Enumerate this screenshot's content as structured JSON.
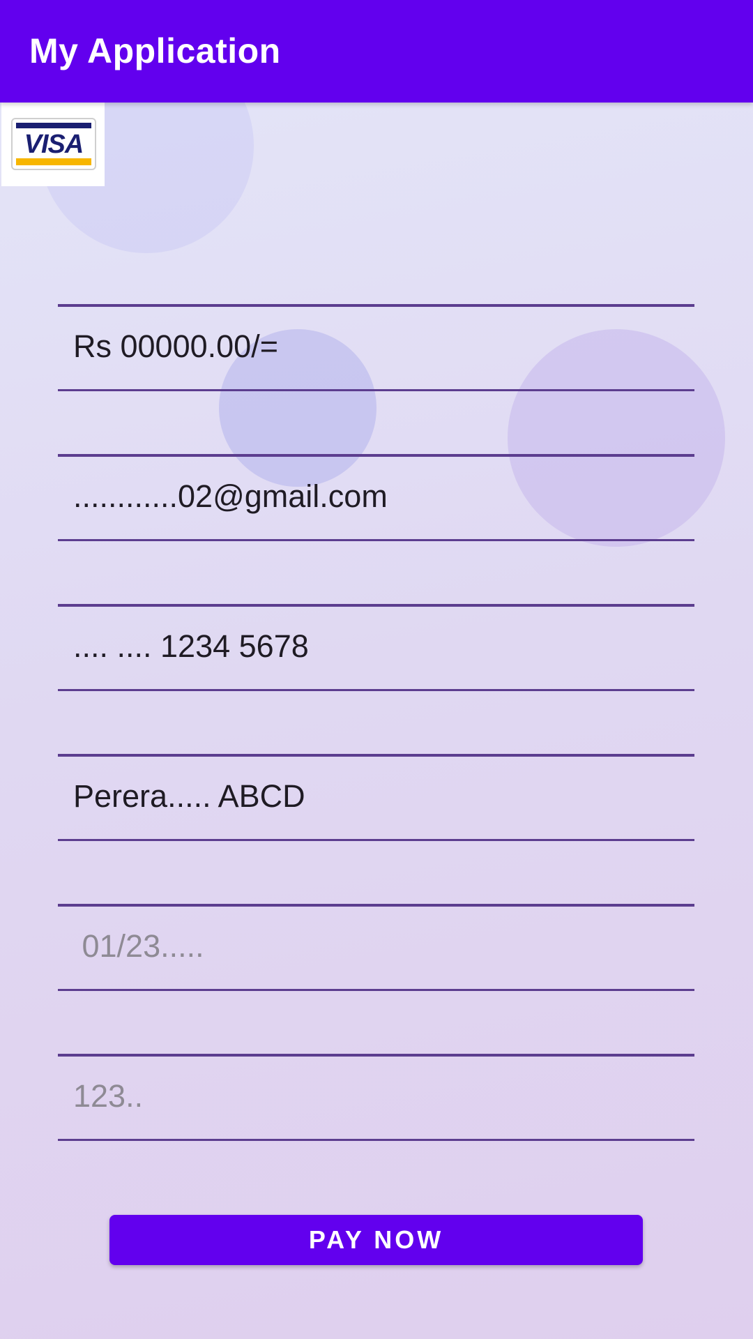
{
  "app_bar": {
    "title": "My Application",
    "color": "#6200ee"
  },
  "card_logo": {
    "icon": "visa-card-icon",
    "brand_text": "VISA"
  },
  "form": {
    "amount": {
      "value": "Rs 00000.00/="
    },
    "email": {
      "value": "............02@gmail.com"
    },
    "card_number": {
      "value": ".... .... 1234 5678"
    },
    "card_holder": {
      "value": "Perera..... ABCD"
    },
    "expiry": {
      "placeholder": " 01/23....."
    },
    "cvv": {
      "placeholder": "123.."
    }
  },
  "pay_button": {
    "label": "PAY NOW"
  }
}
